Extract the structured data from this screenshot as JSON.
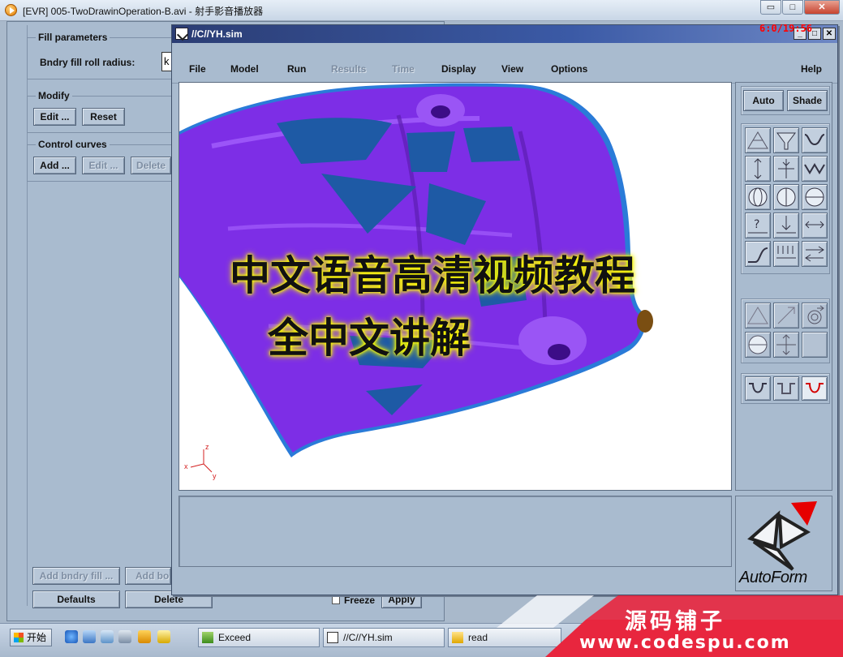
{
  "player": {
    "title": "[EVR] 005-TwoDrawinOperation-B.avi - 射手影音播放器",
    "minimize": "▭",
    "maximize": "□",
    "close": "✕",
    "counter": "6:0/19:56"
  },
  "left_panel": {
    "fill_params": {
      "title": "Fill parameters",
      "bndry_label": "Bndry fill roll radius:",
      "bndry_value": "k"
    },
    "modify": {
      "title": "Modify",
      "edit": "Edit ...",
      "reset": "Reset"
    },
    "control_curves": {
      "title": "Control curves",
      "add": "Add ...",
      "edit": "Edit ...",
      "delete": "Delete"
    },
    "bottom": {
      "add_bndry_fill": "Add bndry fill ...",
      "add_other": "Add bo",
      "defaults": "Defaults",
      "delete": "Delete",
      "freeze": "Freeze",
      "apply": "Apply"
    }
  },
  "sim_window": {
    "title": "//C//YH.sim",
    "minimize": "_",
    "maximize": "□",
    "close": "✕",
    "menu": {
      "file": "File",
      "model": "Model",
      "run": "Run",
      "results": "Results",
      "time": "Time",
      "display": "Display",
      "view": "View",
      "options": "Options",
      "help": "Help"
    },
    "tools": {
      "auto": "Auto",
      "shade": "Shade"
    },
    "axes": {
      "z": "z",
      "x": "x",
      "y": "y"
    },
    "logo": "AutoForm"
  },
  "overlay": {
    "line1": "中文语音高清视频教程",
    "line2": "全中文讲解"
  },
  "taskbar": {
    "start": "开始",
    "items": [
      "Exceed",
      "//C//YH.sim",
      "read"
    ]
  },
  "watermark": {
    "title": "源码铺子",
    "url": "www.codespu.com"
  },
  "colors": {
    "part_purple": "#7d2ee6",
    "part_blue": "#1e5aa5",
    "accent_red": "#e60000",
    "watermark_red": "#e8263e"
  }
}
